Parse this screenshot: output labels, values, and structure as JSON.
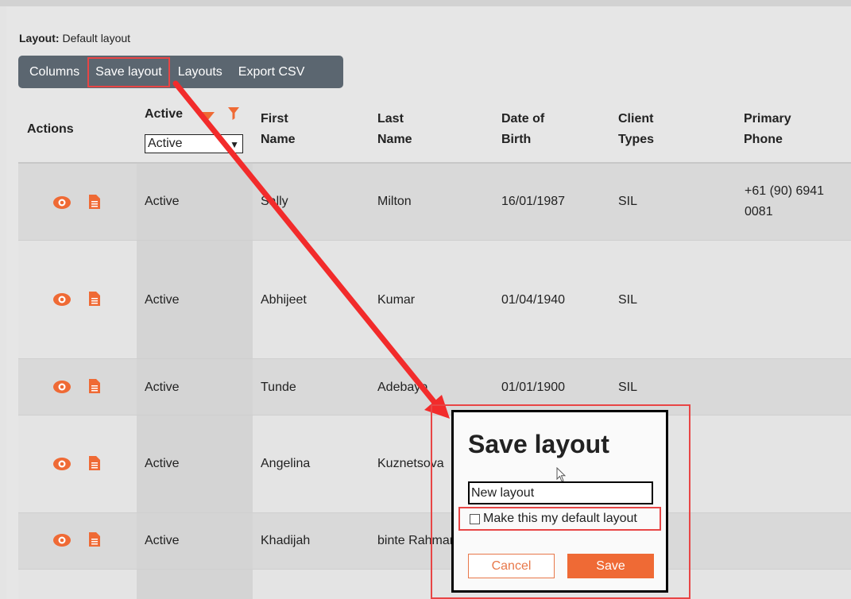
{
  "layout_bar": {
    "label": "Layout:",
    "value": "Default layout"
  },
  "toolbar": {
    "columns": "Columns",
    "save_layout": "Save layout",
    "layouts": "Layouts",
    "export_csv": "Export CSV"
  },
  "headers": {
    "actions": "Actions",
    "active": "Active",
    "active_filter_value": "Active",
    "first_name_1": "First",
    "first_name_2": "Name",
    "last_name_1": "Last",
    "last_name_2": "Name",
    "dob_1": "Date of",
    "dob_2": "Birth",
    "client_types_1": "Client",
    "client_types_2": "Types",
    "phone_1": "Primary",
    "phone_2": "Phone"
  },
  "rows": [
    {
      "active": "Active",
      "first": "Sally",
      "last": "Milton",
      "dob": "16/01/1987",
      "type": "SIL",
      "phone_1": "+61 (90) 6941",
      "phone_2": "0081"
    },
    {
      "active": "Active",
      "first": "Abhijeet",
      "last": "Kumar",
      "dob": "01/04/1940",
      "type": "SIL",
      "phone_1": "",
      "phone_2": ""
    },
    {
      "active": "Active",
      "first": "Tunde",
      "last": "Adebayo",
      "dob": "01/01/1900",
      "type": "SIL",
      "phone_1": "",
      "phone_2": ""
    },
    {
      "active": "Active",
      "first": "Angelina",
      "last": "Kuznetsova",
      "dob": "",
      "type": "",
      "phone_1": "",
      "phone_2": ""
    },
    {
      "active": "Active",
      "first": "Khadijah",
      "last": "binte Rahman",
      "dob": "",
      "type": "",
      "phone_1": "",
      "phone_2": ""
    }
  ],
  "modal": {
    "title": "Save layout",
    "input_value": "New layout",
    "default_checkbox_label": "Make this my default layout",
    "cancel": "Cancel",
    "save": "Save"
  },
  "colors": {
    "accent": "#ef6a35",
    "highlight": "#e84545",
    "toolbar": "#5b6670"
  }
}
